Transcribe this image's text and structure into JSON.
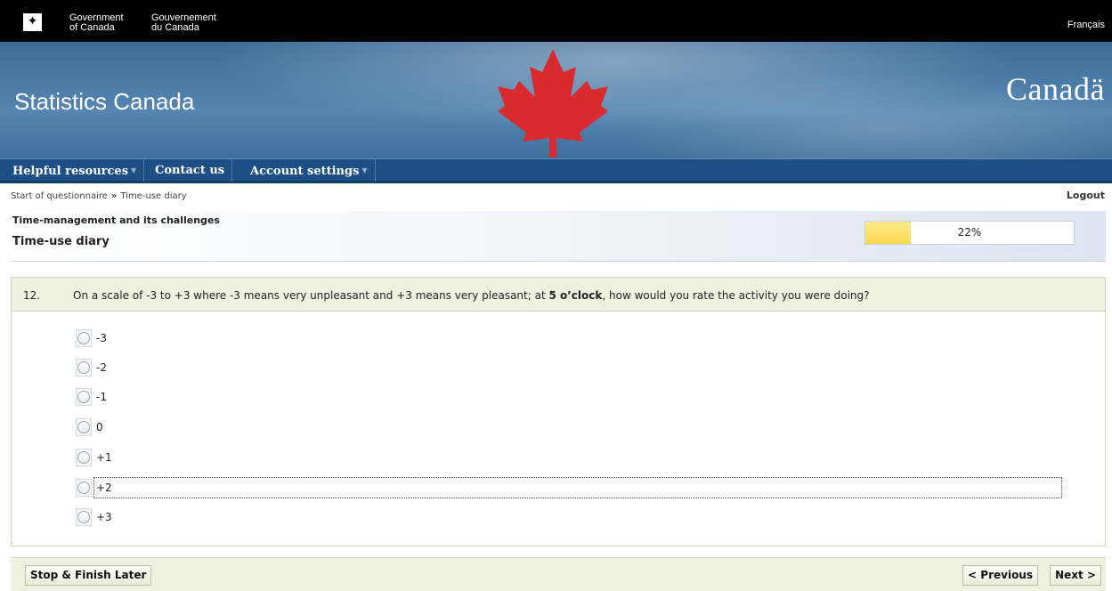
{
  "fip": {
    "gov_en_line1": "Government",
    "gov_en_line2": "of Canada",
    "gov_fr_line1": "Gouvernement",
    "gov_fr_line2": "du Canada",
    "language_link": "Français"
  },
  "banner": {
    "site_title": "Statistics Canada",
    "wordmark": "Canadä",
    "leaf_color": "#d92a2f"
  },
  "nav": {
    "items": [
      {
        "label": "Helpful resources",
        "has_menu": true
      },
      {
        "label": "Contact us",
        "has_menu": false
      },
      {
        "label": "Account settings",
        "has_menu": true
      }
    ]
  },
  "breadcrumb": {
    "items": [
      "Start of questionnaire",
      "Time-use diary"
    ],
    "separator": "»"
  },
  "logout_label": "Logout",
  "header": {
    "section_title": "Time-management and its challenges",
    "page_title": "Time-use diary",
    "progress_percent": 22,
    "progress_text": "22%"
  },
  "question": {
    "number": "12.",
    "text_before": "On a scale of -3 to +3 where -3 means very unpleasant and +3 means very pleasant; at ",
    "text_bold": "5 o’clock",
    "text_after": ", how would you rate the activity you were doing?",
    "options": [
      "-3",
      "-2",
      "-1",
      "0",
      "+1",
      "+2",
      "+3"
    ],
    "focused_option": "+2"
  },
  "footer": {
    "stop_label": "Stop & Finish Later",
    "previous_label": "< Previous",
    "next_label": "Next >"
  }
}
